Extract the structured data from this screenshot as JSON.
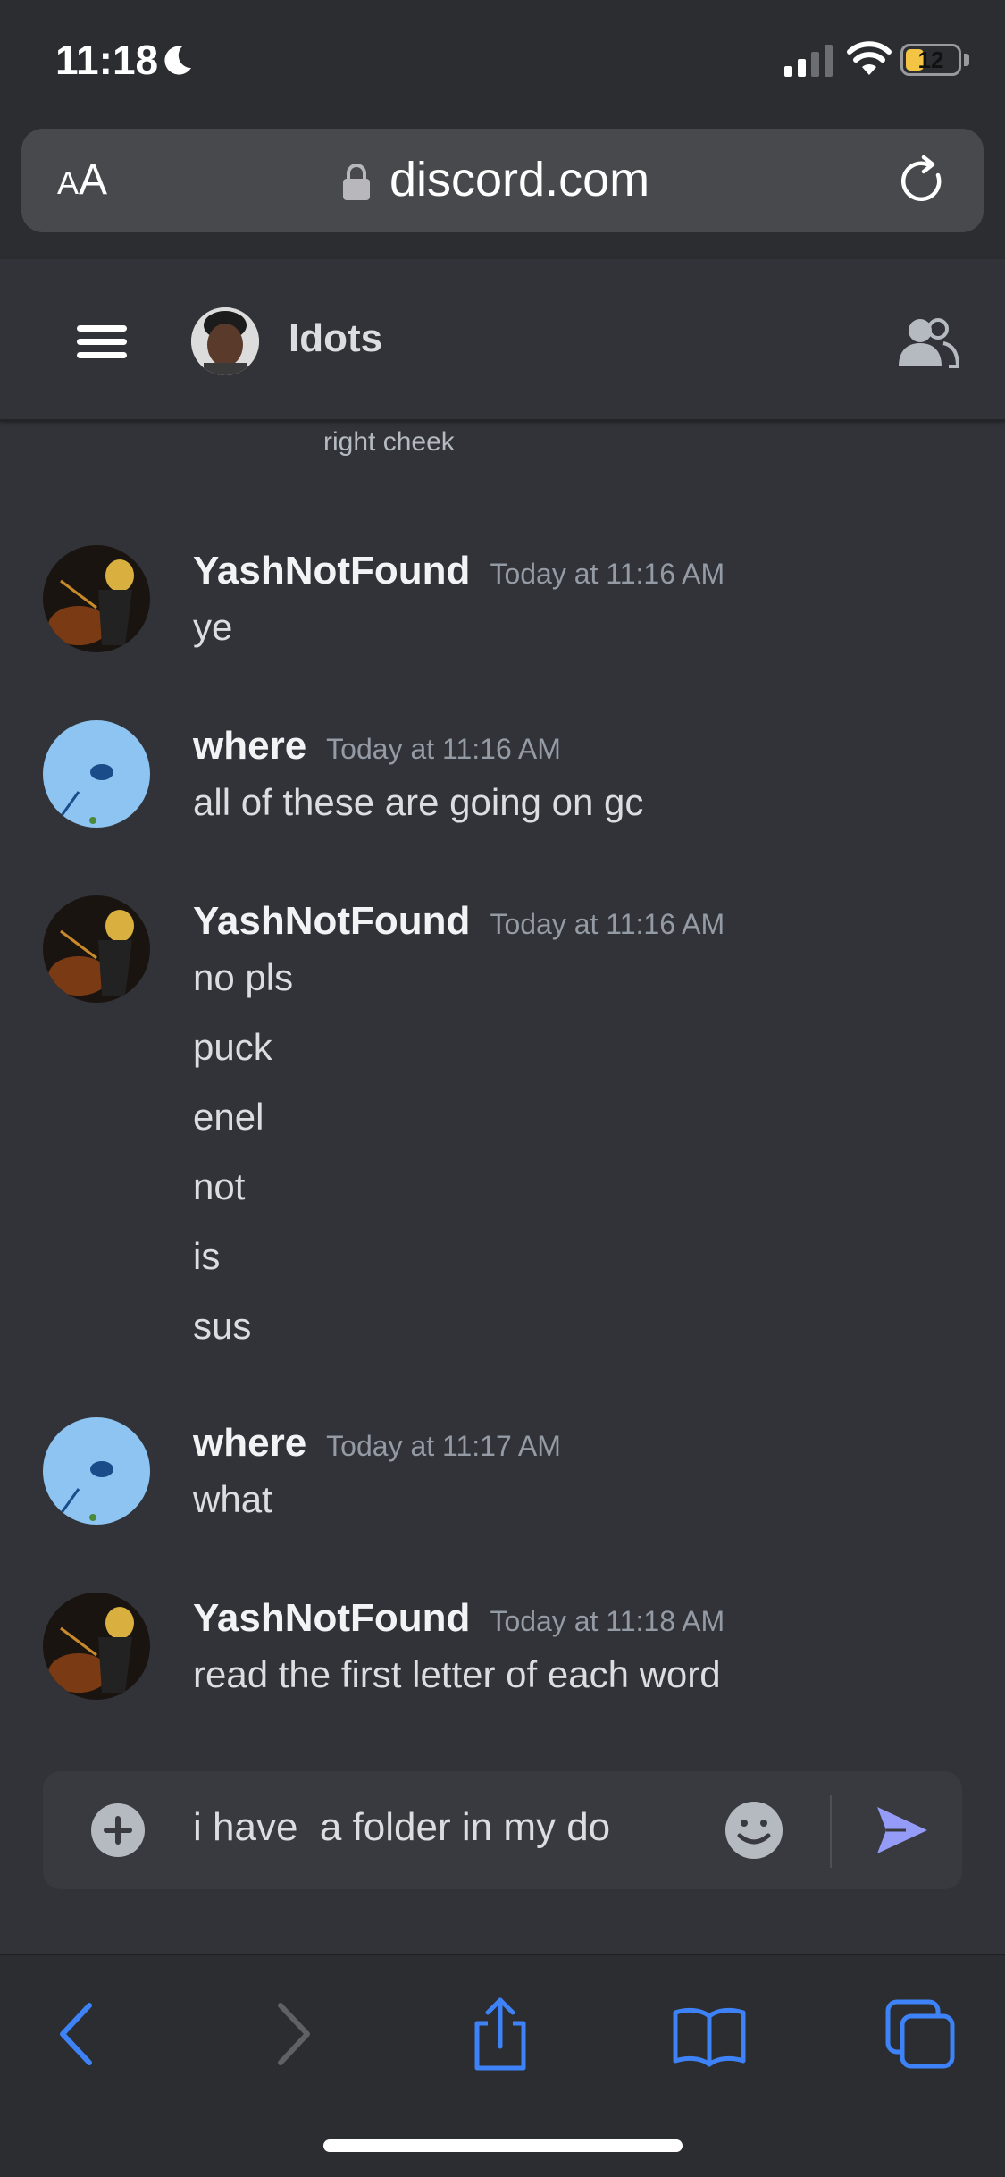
{
  "status_bar": {
    "time": "11:18",
    "battery_level": "12",
    "icons": [
      "moon-icon",
      "signal-icon",
      "wifi-icon",
      "battery-icon"
    ]
  },
  "browser": {
    "aa_label_big": "A",
    "aa_label_small": "A",
    "url": "discord.com"
  },
  "channel": {
    "name": "Idots"
  },
  "messages": {
    "reply_fragment": "right cheek",
    "items": [
      {
        "author": "YashNotFound",
        "time": "Today at 11:16 AM",
        "lines": [
          "ye"
        ],
        "avatar": "sanji"
      },
      {
        "author": "where",
        "time": "Today at 11:16 AM",
        "lines": [
          "all of these are going on gc"
        ],
        "avatar": "blue"
      },
      {
        "author": "YashNotFound",
        "time": "Today at 11:16 AM",
        "lines": [
          "no pls",
          "puck",
          "enel",
          "not",
          "is",
          "sus"
        ],
        "avatar": "sanji"
      },
      {
        "author": "where",
        "time": "Today at 11:17 AM",
        "lines": [
          "what"
        ],
        "avatar": "blue"
      },
      {
        "author": "YashNotFound",
        "time": "Today at 11:18 AM",
        "lines": [
          "read the first letter of each word"
        ],
        "avatar": "sanji"
      }
    ]
  },
  "composer": {
    "text": "i have  a folder in my do"
  },
  "colors": {
    "background": "#313338",
    "accent_send": "#949cf7",
    "safari_blue": "#3e82f7"
  }
}
